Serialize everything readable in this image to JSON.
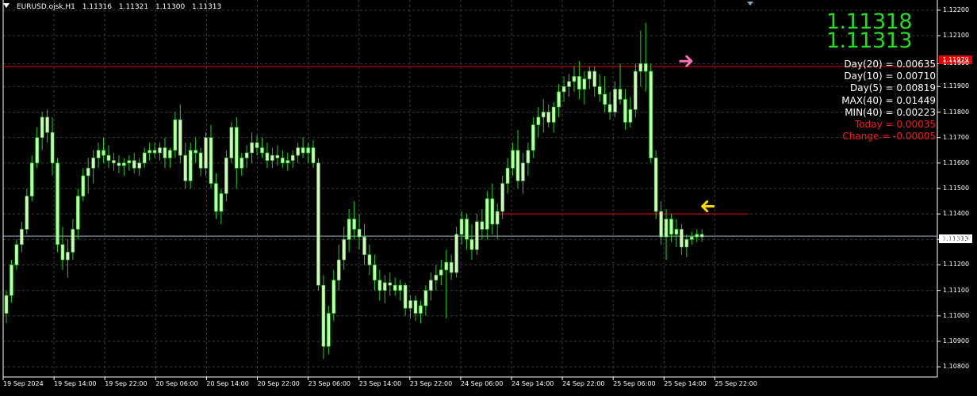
{
  "header": {
    "symbol_tf": "EURUSD.ojsk,H1",
    "open": "1.11316",
    "high": "1.11321",
    "low": "1.11300",
    "close": "1.11313"
  },
  "quotes": {
    "bid": "1.11318",
    "ask": "1.11313"
  },
  "stats": [
    {
      "text": "Day(20) = 0.00635",
      "color": "white"
    },
    {
      "text": "Day(10) = 0.00710",
      "color": "white"
    },
    {
      "text": "Day(5) = 0.00819",
      "color": "white"
    },
    {
      "text": "MAX(40) = 0.01449",
      "color": "white"
    },
    {
      "text": "MIN(40) = 0.00223",
      "color": "white"
    },
    {
      "text": "Today = 0.00035",
      "color": "red"
    },
    {
      "text": "Change = -0.00005",
      "color": "red"
    }
  ],
  "price_labels": {
    "red_line": "1.11979",
    "current": "1.11313"
  },
  "colors": {
    "background": "#000000",
    "grid": "#3a3a3a",
    "candle": "#c8ffb4",
    "wick": "#19d219",
    "red_line": "#e60000",
    "current_line": "#9fb8c8",
    "arrow_pink": "#ff6eb4",
    "arrow_yellow": "#ffd700"
  },
  "chart_data": {
    "type": "candlestick",
    "symbol": "EURUSD.ojsk",
    "timeframe": "H1",
    "ylim": [
      1.1076,
      1.1224
    ],
    "y_ticks": [
      "1.12200",
      "1.12100",
      "1.11990",
      "1.11900",
      "1.11800",
      "1.11700",
      "1.11600",
      "1.11500",
      "1.11400",
      "1.11300",
      "1.11200",
      "1.11100",
      "1.11000",
      "1.10900",
      "1.10800"
    ],
    "x_ticks": [
      "19 Sep 2024",
      "19 Sep 14:00",
      "19 Sep 22:00",
      "20 Sep 06:00",
      "20 Sep 14:00",
      "20 Sep 22:00",
      "23 Sep 06:00",
      "23 Sep 14:00",
      "23 Sep 22:00",
      "24 Sep 06:00",
      "24 Sep 14:00",
      "24 Sep 22:00",
      "25 Sep 06:00",
      "25 Sep 14:00",
      "25 Sep 22:00"
    ],
    "horizontal_lines": [
      {
        "price": 1.11979,
        "style": "solid",
        "color": "red"
      },
      {
        "price": 1.11313,
        "style": "solid",
        "color": "current"
      },
      {
        "price": 1.114,
        "from_bar": 96,
        "to_bar": 145,
        "style": "solid",
        "color": "red"
      }
    ],
    "arrows": [
      {
        "bar": 133,
        "price": 1.12,
        "direction": "right",
        "color": "pink"
      },
      {
        "bar": 137,
        "price": 1.1143,
        "direction": "left",
        "color": "yellow"
      }
    ],
    "ohlc": [
      [
        1.1101,
        1.111,
        1.1097,
        1.1108
      ],
      [
        1.1108,
        1.1122,
        1.1105,
        1.112
      ],
      [
        1.112,
        1.113,
        1.1118,
        1.1128
      ],
      [
        1.1128,
        1.1137,
        1.1125,
        1.1134
      ],
      [
        1.1134,
        1.115,
        1.1132,
        1.1147
      ],
      [
        1.1147,
        1.1163,
        1.1145,
        1.116
      ],
      [
        1.116,
        1.1174,
        1.1158,
        1.117
      ],
      [
        1.117,
        1.118,
        1.1165,
        1.1178
      ],
      [
        1.1178,
        1.1181,
        1.1168,
        1.1172
      ],
      [
        1.1172,
        1.1178,
        1.1155,
        1.116
      ],
      [
        1.116,
        1.1162,
        1.1125,
        1.1128
      ],
      [
        1.1128,
        1.1135,
        1.1118,
        1.1122
      ],
      [
        1.1122,
        1.113,
        1.1115,
        1.1125
      ],
      [
        1.1125,
        1.1138,
        1.1122,
        1.1134
      ],
      [
        1.1134,
        1.115,
        1.113,
        1.1147
      ],
      [
        1.1147,
        1.1158,
        1.1145,
        1.1155
      ],
      [
        1.1155,
        1.1162,
        1.1148,
        1.1158
      ],
      [
        1.1158,
        1.1165,
        1.1152,
        1.1162
      ],
      [
        1.1162,
        1.1168,
        1.1158,
        1.1165
      ],
      [
        1.1165,
        1.117,
        1.116,
        1.1163
      ],
      [
        1.1163,
        1.1167,
        1.1158,
        1.1161
      ],
      [
        1.1161,
        1.1164,
        1.1157,
        1.116
      ],
      [
        1.116,
        1.1163,
        1.1156,
        1.1159
      ],
      [
        1.1159,
        1.1162,
        1.1155,
        1.116
      ],
      [
        1.116,
        1.1163,
        1.1157,
        1.1161
      ],
      [
        1.1161,
        1.1164,
        1.1156,
        1.1158
      ],
      [
        1.1158,
        1.1162,
        1.1155,
        1.116
      ],
      [
        1.116,
        1.1166,
        1.1158,
        1.1164
      ],
      [
        1.1164,
        1.1168,
        1.1161,
        1.1165
      ],
      [
        1.1165,
        1.1168,
        1.1162,
        1.1164
      ],
      [
        1.1164,
        1.1168,
        1.1161,
        1.1166
      ],
      [
        1.1166,
        1.117,
        1.1158,
        1.1162
      ],
      [
        1.1162,
        1.1166,
        1.1158,
        1.1165
      ],
      [
        1.1165,
        1.118,
        1.1162,
        1.1177
      ],
      [
        1.1177,
        1.1183,
        1.116,
        1.1163
      ],
      [
        1.1163,
        1.1168,
        1.115,
        1.1153
      ],
      [
        1.1153,
        1.1168,
        1.115,
        1.1165
      ],
      [
        1.1165,
        1.117,
        1.116,
        1.1164
      ],
      [
        1.1164,
        1.1166,
        1.1155,
        1.1158
      ],
      [
        1.1158,
        1.1172,
        1.1155,
        1.117
      ],
      [
        1.117,
        1.1175,
        1.115,
        1.1152
      ],
      [
        1.1152,
        1.1156,
        1.1138,
        1.1141
      ],
      [
        1.1141,
        1.115,
        1.1136,
        1.1148
      ],
      [
        1.1148,
        1.1165,
        1.1145,
        1.1162
      ],
      [
        1.1162,
        1.1176,
        1.116,
        1.1174
      ],
      [
        1.1174,
        1.1178,
        1.115,
        1.1158
      ],
      [
        1.1158,
        1.1164,
        1.1155,
        1.1162
      ],
      [
        1.1162,
        1.1167,
        1.1158,
        1.1164
      ],
      [
        1.1164,
        1.1172,
        1.116,
        1.1168
      ],
      [
        1.1168,
        1.1171,
        1.1163,
        1.1166
      ],
      [
        1.1166,
        1.117,
        1.1162,
        1.1164
      ],
      [
        1.1164,
        1.1168,
        1.1158,
        1.1161
      ],
      [
        1.1161,
        1.1166,
        1.1158,
        1.1163
      ],
      [
        1.1163,
        1.1167,
        1.1159,
        1.1162
      ],
      [
        1.1162,
        1.1165,
        1.1158,
        1.116
      ],
      [
        1.116,
        1.1164,
        1.1157,
        1.1161
      ],
      [
        1.1161,
        1.1165,
        1.1158,
        1.1163
      ],
      [
        1.1163,
        1.1168,
        1.116,
        1.1166
      ],
      [
        1.1166,
        1.117,
        1.1162,
        1.1164
      ],
      [
        1.1164,
        1.1168,
        1.116,
        1.1166
      ],
      [
        1.1166,
        1.1169,
        1.1158,
        1.116
      ],
      [
        1.116,
        1.1162,
        1.111,
        1.1112
      ],
      [
        1.1112,
        1.1116,
        1.1083,
        1.1088
      ],
      [
        1.1088,
        1.1104,
        1.1085,
        1.1101
      ],
      [
        1.1101,
        1.1118,
        1.1098,
        1.1114
      ],
      [
        1.1114,
        1.1128,
        1.111,
        1.1122
      ],
      [
        1.1122,
        1.1135,
        1.1118,
        1.113
      ],
      [
        1.113,
        1.1142,
        1.1125,
        1.1138
      ],
      [
        1.1138,
        1.1145,
        1.113,
        1.1134
      ],
      [
        1.1134,
        1.114,
        1.1126,
        1.1131
      ],
      [
        1.1131,
        1.1136,
        1.112,
        1.1124
      ],
      [
        1.1124,
        1.1128,
        1.1116,
        1.112
      ],
      [
        1.112,
        1.1124,
        1.111,
        1.1114
      ],
      [
        1.1114,
        1.1118,
        1.1106,
        1.111
      ],
      [
        1.111,
        1.1116,
        1.1105,
        1.1113
      ],
      [
        1.1113,
        1.1117,
        1.1108,
        1.1112
      ],
      [
        1.1112,
        1.1115,
        1.1108,
        1.111
      ],
      [
        1.111,
        1.1114,
        1.1106,
        1.1112
      ],
      [
        1.1112,
        1.1113,
        1.11,
        1.1103
      ],
      [
        1.1103,
        1.1108,
        1.1099,
        1.1106
      ],
      [
        1.1106,
        1.1108,
        1.1098,
        1.1101
      ],
      [
        1.1101,
        1.1106,
        1.1097,
        1.1104
      ],
      [
        1.1104,
        1.1112,
        1.11,
        1.111
      ],
      [
        1.111,
        1.1117,
        1.1106,
        1.1114
      ],
      [
        1.1114,
        1.112,
        1.111,
        1.1116
      ],
      [
        1.1116,
        1.1122,
        1.1112,
        1.1118
      ],
      [
        1.1118,
        1.1126,
        1.1099,
        1.1121
      ],
      [
        1.1121,
        1.1124,
        1.1114,
        1.1117
      ],
      [
        1.1117,
        1.1135,
        1.1115,
        1.1132
      ],
      [
        1.1132,
        1.1141,
        1.1128,
        1.1138
      ],
      [
        1.1138,
        1.114,
        1.1126,
        1.113
      ],
      [
        1.113,
        1.1136,
        1.1122,
        1.1126
      ],
      [
        1.1126,
        1.114,
        1.1124,
        1.1137
      ],
      [
        1.1137,
        1.1142,
        1.113,
        1.1134
      ],
      [
        1.1134,
        1.1149,
        1.113,
        1.1146
      ],
      [
        1.1146,
        1.1152,
        1.1132,
        1.1136
      ],
      [
        1.1136,
        1.1144,
        1.113,
        1.1141
      ],
      [
        1.1141,
        1.1155,
        1.1138,
        1.1152
      ],
      [
        1.1152,
        1.1162,
        1.1148,
        1.1158
      ],
      [
        1.1158,
        1.1168,
        1.1155,
        1.1165
      ],
      [
        1.1165,
        1.1173,
        1.115,
        1.1153
      ],
      [
        1.1153,
        1.1164,
        1.1148,
        1.116
      ],
      [
        1.116,
        1.1168,
        1.1155,
        1.1165
      ],
      [
        1.1165,
        1.1178,
        1.1162,
        1.1175
      ],
      [
        1.1175,
        1.1182,
        1.117,
        1.1178
      ],
      [
        1.1178,
        1.1185,
        1.1172,
        1.118
      ],
      [
        1.118,
        1.1183,
        1.1174,
        1.1176
      ],
      [
        1.1176,
        1.1184,
        1.1172,
        1.1182
      ],
      [
        1.1182,
        1.1191,
        1.1178,
        1.1188
      ],
      [
        1.1188,
        1.1194,
        1.1184,
        1.119
      ],
      [
        1.119,
        1.1195,
        1.1186,
        1.1192
      ],
      [
        1.1192,
        1.1198,
        1.1188,
        1.1194
      ],
      [
        1.1194,
        1.12,
        1.1185,
        1.1189
      ],
      [
        1.1189,
        1.1196,
        1.1183,
        1.1193
      ],
      [
        1.1193,
        1.1198,
        1.1189,
        1.1196
      ],
      [
        1.1196,
        1.1198,
        1.1186,
        1.119
      ],
      [
        1.119,
        1.1195,
        1.1184,
        1.1187
      ],
      [
        1.1187,
        1.1194,
        1.118,
        1.1183
      ],
      [
        1.1183,
        1.1188,
        1.1177,
        1.118
      ],
      [
        1.118,
        1.1192,
        1.1178,
        1.1189
      ],
      [
        1.1189,
        1.1199,
        1.1183,
        1.1185
      ],
      [
        1.1185,
        1.1189,
        1.1173,
        1.1176
      ],
      [
        1.1176,
        1.1186,
        1.1174,
        1.1181
      ],
      [
        1.1181,
        1.1199,
        1.1178,
        1.1196
      ],
      [
        1.1196,
        1.1212,
        1.119,
        1.1199
      ],
      [
        1.1199,
        1.1215,
        1.1188,
        1.1196
      ],
      [
        1.1196,
        1.1199,
        1.116,
        1.1162
      ],
      [
        1.1162,
        1.1165,
        1.1138,
        1.1141
      ],
      [
        1.1141,
        1.1145,
        1.1128,
        1.1131
      ],
      [
        1.1131,
        1.1142,
        1.1122,
        1.1138
      ],
      [
        1.1138,
        1.114,
        1.1129,
        1.1132
      ],
      [
        1.1132,
        1.1138,
        1.1127,
        1.1134
      ],
      [
        1.1134,
        1.1136,
        1.1124,
        1.1127
      ],
      [
        1.1127,
        1.1132,
        1.1123,
        1.113
      ],
      [
        1.113,
        1.1133,
        1.1128,
        1.1131
      ],
      [
        1.1131,
        1.1134,
        1.1129,
        1.1132
      ],
      [
        1.1132,
        1.1134,
        1.1129,
        1.1131
      ]
    ]
  }
}
